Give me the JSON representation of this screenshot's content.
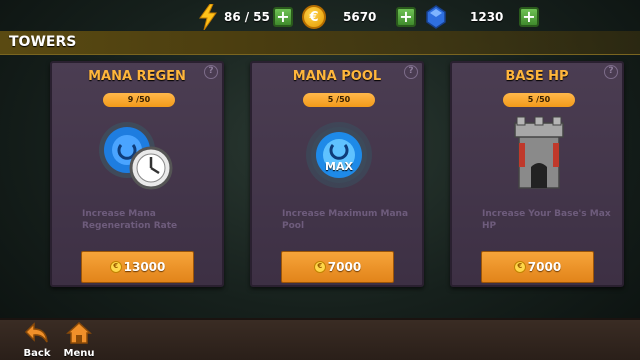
{
  "resources": {
    "energy": {
      "icon": "lightning-icon",
      "current": "86",
      "separator": "/",
      "max": "55"
    },
    "gold": {
      "icon": "coin-icon",
      "symbol": "€",
      "value": "5670"
    },
    "gems": {
      "icon": "gem-icon",
      "value": "1230"
    }
  },
  "header": {
    "title": "TOWERS"
  },
  "cards": [
    {
      "title": "MANA REGEN",
      "level": "9 /50",
      "desc": "Increase Mana Regeneration Rate",
      "price": "13000",
      "coin": "€",
      "help": "?",
      "icon": "mana-regen-clock-icon"
    },
    {
      "title": "MANA POOL",
      "level": "5 /50",
      "desc": "Increase Maximum Mana Pool",
      "price": "7000",
      "coin": "€",
      "help": "?",
      "icon": "mana-orb-icon",
      "badge": "MAX"
    },
    {
      "title": "BASE HP",
      "level": "5 /50",
      "desc": "Increase Your Base's Max HP",
      "price": "7000",
      "coin": "€",
      "help": "?",
      "icon": "castle-tower-icon"
    }
  ],
  "nav": {
    "back": "Back",
    "menu": "Menu"
  },
  "colors": {
    "accent": "#ffb63c",
    "buy": "#f29a2a",
    "card": "#45374c",
    "plus": "#4fa33a"
  }
}
